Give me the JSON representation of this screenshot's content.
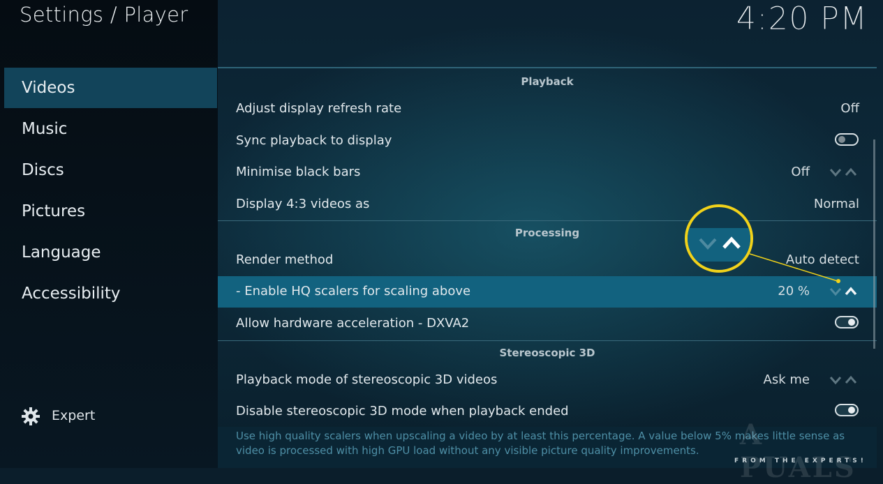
{
  "header": {
    "title": "Settings / Player",
    "clock": "4:20 PM"
  },
  "sidebar": {
    "items": [
      {
        "label": "Videos",
        "active": true
      },
      {
        "label": "Music"
      },
      {
        "label": "Discs"
      },
      {
        "label": "Pictures"
      },
      {
        "label": "Language"
      },
      {
        "label": "Accessibility"
      }
    ],
    "expert_label": "Expert",
    "expert_icon": "gear-icon"
  },
  "sections": {
    "playback": "Playback",
    "processing": "Processing",
    "stereo": "Stereoscopic 3D"
  },
  "rows": {
    "refresh_rate": {
      "label": "Adjust display refresh rate",
      "value": "Off"
    },
    "sync_playback": {
      "label": "Sync playback to display",
      "toggle": "off"
    },
    "black_bars": {
      "label": "Minimise black bars",
      "value": "Off"
    },
    "display_43": {
      "label": "Display 4:3 videos as",
      "value": "Normal"
    },
    "render_method": {
      "label": "Render method",
      "value": "Auto detect"
    },
    "hq_scalers": {
      "label": "- Enable HQ scalers for scaling above",
      "value": "20 %"
    },
    "hw_accel": {
      "label": "Allow hardware acceleration - DXVA2",
      "toggle": "on"
    },
    "stereo_mode": {
      "label": "Playback mode of stereoscopic 3D videos",
      "value": "Ask me"
    },
    "disable_stereo": {
      "label": "Disable stereoscopic 3D mode when playback ended",
      "toggle": "on"
    }
  },
  "description": {
    "line1": "Use high quality scalers when upscaling a video by at least this percentage. A value below 5% makes little sense as",
    "line2": "video is processed with high GPU load without any visible picture quality improvements."
  },
  "watermark": {
    "text": "A PUALS",
    "subtext": "FROM THE EXPERTS!"
  },
  "colors": {
    "highlight": "#12627f",
    "callout": "#f1d21a",
    "active_nav": "#12445a"
  }
}
